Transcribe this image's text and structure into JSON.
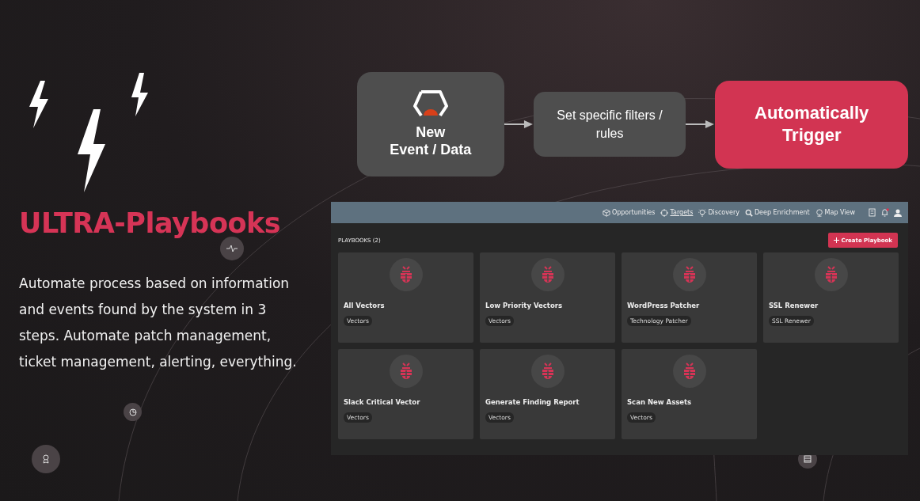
{
  "hero": {
    "title": "ULTRA-Playbooks",
    "description": "Automate process based on information and events found by the system in 3 steps. Automate patch management, ticket management, alerting, everything."
  },
  "flow": {
    "steps": [
      {
        "kind": "source",
        "lines": [
          "New",
          "Event / Data"
        ]
      },
      {
        "kind": "filter",
        "lines": [
          "Set specific filters /",
          "rules"
        ]
      },
      {
        "kind": "action",
        "lines": [
          "Automatically",
          "Trigger"
        ]
      }
    ]
  },
  "app": {
    "nav": [
      {
        "label": "Opportunities",
        "selected": false
      },
      {
        "label": "Targets",
        "selected": true
      },
      {
        "label": "Discovery",
        "selected": false
      },
      {
        "label": "Deep Enrichment",
        "selected": false
      },
      {
        "label": "Map View",
        "selected": false
      }
    ],
    "section_title": "PLAYBOOKS (2)",
    "create_button": "Create Playbook",
    "cards": [
      {
        "title": "All Vectors",
        "tag": "Vectors"
      },
      {
        "title": "Low Priority Vectors",
        "tag": "Vectors"
      },
      {
        "title": "WordPress Patcher",
        "tag": "Technology Patcher"
      },
      {
        "title": "SSL Renewer",
        "tag": "SSL Renewer"
      },
      {
        "title": "Slack Critical Vector",
        "tag": "Vectors"
      },
      {
        "title": "Generate Finding Report",
        "tag": "Vectors"
      },
      {
        "title": "Scan New Assets",
        "tag": "Vectors"
      }
    ]
  }
}
